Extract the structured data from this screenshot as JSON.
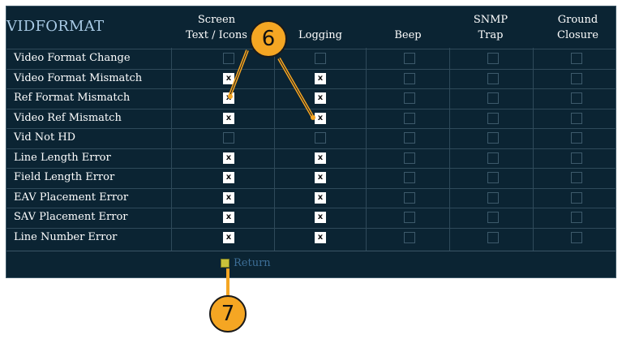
{
  "panel": {
    "title": "VIDFORMAT",
    "columns": [
      {
        "line1": "Screen",
        "line2": "Text / Icons"
      },
      {
        "line1": "",
        "line2": "Logging"
      },
      {
        "line1": "",
        "line2": "Beep"
      },
      {
        "line1": "SNMP",
        "line2": "Trap"
      },
      {
        "line1": "Ground",
        "line2": "Closure"
      }
    ],
    "rows": [
      {
        "label": "Video Format Change",
        "checks": [
          false,
          false,
          false,
          false,
          false
        ]
      },
      {
        "label": "Video Format Mismatch",
        "checks": [
          true,
          true,
          false,
          false,
          false
        ]
      },
      {
        "label": "Ref Format Mismatch",
        "checks": [
          true,
          true,
          false,
          false,
          false
        ]
      },
      {
        "label": "Video Ref Mismatch",
        "checks": [
          true,
          true,
          false,
          false,
          false
        ]
      },
      {
        "label": "Vid Not HD",
        "checks": [
          false,
          false,
          false,
          false,
          false
        ]
      },
      {
        "label": "Line Length Error",
        "checks": [
          true,
          true,
          false,
          false,
          false
        ]
      },
      {
        "label": "Field Length Error",
        "checks": [
          true,
          true,
          false,
          false,
          false
        ]
      },
      {
        "label": "EAV Placement Error",
        "checks": [
          true,
          true,
          false,
          false,
          false
        ]
      },
      {
        "label": "SAV Placement Error",
        "checks": [
          true,
          true,
          false,
          false,
          false
        ]
      },
      {
        "label": "Line Number Error",
        "checks": [
          true,
          true,
          false,
          false,
          false
        ]
      }
    ],
    "check_mark": "x",
    "return_label": "Return"
  },
  "callouts": {
    "six": "6",
    "seven": "7"
  },
  "colors": {
    "panel_bg": "#0b2433",
    "title": "#a9cbe6",
    "callout": "#f5a623",
    "return_box": "#c9c23a"
  }
}
